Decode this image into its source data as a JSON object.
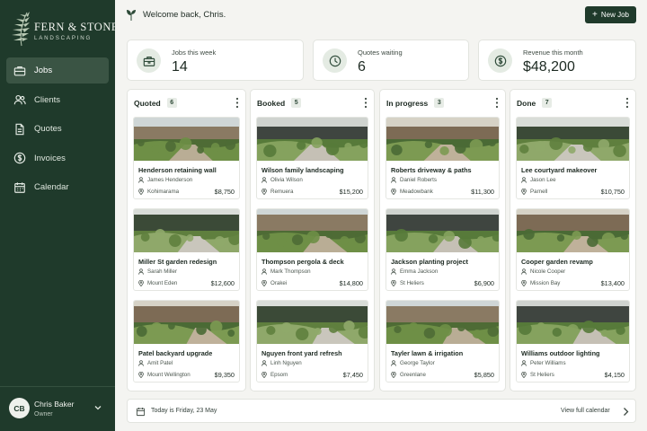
{
  "brand": {
    "name": "FERN & STONE",
    "tagline": "LANDSCAPING"
  },
  "nav": [
    {
      "label": "Jobs",
      "icon": "briefcase-icon",
      "active": true
    },
    {
      "label": "Clients",
      "icon": "users-icon"
    },
    {
      "label": "Quotes",
      "icon": "document-icon"
    },
    {
      "label": "Invoices",
      "icon": "dollar-circle-icon"
    },
    {
      "label": "Calendar",
      "icon": "calendar-icon"
    }
  ],
  "user": {
    "initials": "CB",
    "name": "Chris Baker",
    "role": "Owner"
  },
  "header": {
    "welcome": "Welcome back, Chris.",
    "new_job": "New Job"
  },
  "stats": [
    {
      "label": "Jobs this week",
      "value": "14",
      "icon": "toolbox-icon"
    },
    {
      "label": "Quotes waiting",
      "value": "6",
      "icon": "clock-icon"
    },
    {
      "label": "Revenue this month",
      "value": "$48,200",
      "icon": "dollar-icon"
    }
  ],
  "columns": [
    {
      "title": "Quoted",
      "count": "6",
      "cards": [
        {
          "title": "Henderson retaining wall",
          "client": "James Henderson",
          "location": "Kohimarama",
          "amount": "$8,750"
        },
        {
          "title": "Miller St garden redesign",
          "client": "Sarah Miller",
          "location": "Mount Eden",
          "amount": "$12,600"
        },
        {
          "title": "Patel backyard upgrade",
          "client": "Amit Patel",
          "location": "Mount Wellington",
          "amount": "$9,350"
        }
      ]
    },
    {
      "title": "Booked",
      "count": "5",
      "cards": [
        {
          "title": "Wilson family landscaping",
          "client": "Olivia Wilson",
          "location": "Remuera",
          "amount": "$15,200"
        },
        {
          "title": "Thompson pergola & deck",
          "client": "Mark Thompson",
          "location": "Orakei",
          "amount": "$14,800"
        },
        {
          "title": "Nguyen front yard refresh",
          "client": "Linh Nguyen",
          "location": "Epsom",
          "amount": "$7,450"
        }
      ]
    },
    {
      "title": "In progress",
      "count": "3",
      "cards": [
        {
          "title": "Roberts driveway & paths",
          "client": "Daniel Roberts",
          "location": "Meadowbank",
          "amount": "$11,300"
        },
        {
          "title": "Jackson planting project",
          "client": "Emma Jackson",
          "location": "St Heliers",
          "amount": "$6,900"
        },
        {
          "title": "Tayler lawn & irrigation",
          "client": "George Taylor",
          "location": "Greenlane",
          "amount": "$5,850"
        }
      ]
    },
    {
      "title": "Done",
      "count": "7",
      "cards": [
        {
          "title": "Lee courtyard makeover",
          "client": "Jason Lee",
          "location": "Parnell",
          "amount": "$10,750"
        },
        {
          "title": "Cooper garden revamp",
          "client": "Nicole Cooper",
          "location": "Mission Bay",
          "amount": "$13,400"
        },
        {
          "title": "Williams outdoor lighting",
          "client": "Peter Williams",
          "location": "St Heliers",
          "amount": "$4,150"
        }
      ]
    }
  ],
  "footer": {
    "today": "Today is Friday, 23 May",
    "view_calendar": "View full calendar"
  }
}
